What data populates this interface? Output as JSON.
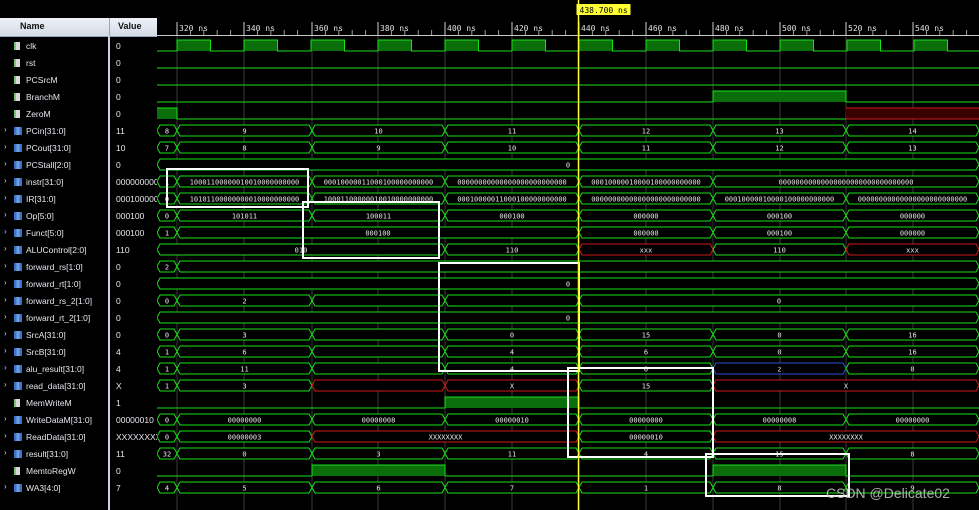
{
  "columns": {
    "name": "Name",
    "value": "Value"
  },
  "cursor": {
    "label": "438.700 ns"
  },
  "ruler": {
    "ticks": [
      "320 ns",
      "340 ns",
      "360 ns",
      "380 ns",
      "400 ns",
      "420 ns",
      "440 ns",
      "460 ns",
      "480 ns",
      "500 ns",
      "520 ns",
      "540 ns"
    ]
  },
  "signals": [
    {
      "name": "clk",
      "value": "0",
      "type": "bit"
    },
    {
      "name": "rst",
      "value": "0",
      "type": "bit"
    },
    {
      "name": "PCSrcM",
      "value": "0",
      "type": "bit"
    },
    {
      "name": "BranchM",
      "value": "0",
      "type": "bit"
    },
    {
      "name": "ZeroM",
      "value": "0",
      "type": "bit"
    },
    {
      "name": "PCin[31:0]",
      "value": "11",
      "type": "bus"
    },
    {
      "name": "PCout[31:0]",
      "value": "10",
      "type": "bus"
    },
    {
      "name": "PCStall[2:0]",
      "value": "0",
      "type": "bus"
    },
    {
      "name": "instr[31:0]",
      "value": "000000000",
      "type": "bus"
    },
    {
      "name": "IR[31:0]",
      "value": "000100000",
      "type": "bus"
    },
    {
      "name": "Op[5:0]",
      "value": "000100",
      "type": "bus"
    },
    {
      "name": "Funct[5:0]",
      "value": "000100",
      "type": "bus"
    },
    {
      "name": "ALUControl[2:0]",
      "value": "110",
      "type": "bus"
    },
    {
      "name": "forward_rs[1:0]",
      "value": "0",
      "type": "bus"
    },
    {
      "name": "forward_rt[1:0]",
      "value": "0",
      "type": "bus"
    },
    {
      "name": "forward_rs_2[1:0]",
      "value": "0",
      "type": "bus"
    },
    {
      "name": "forward_rt_2[1:0]",
      "value": "0",
      "type": "bus"
    },
    {
      "name": "SrcA[31:0]",
      "value": "0",
      "type": "bus"
    },
    {
      "name": "SrcB[31:0]",
      "value": "4",
      "type": "bus"
    },
    {
      "name": "alu_result[31:0]",
      "value": "4",
      "type": "bus"
    },
    {
      "name": "read_data[31:0]",
      "value": "X",
      "type": "bus"
    },
    {
      "name": "MemWriteM",
      "value": "1",
      "type": "bit"
    },
    {
      "name": "WriteDataM[31:0]",
      "value": "00000010",
      "type": "bus"
    },
    {
      "name": "ReadData[31:0]",
      "value": "XXXXXXXX",
      "type": "bus"
    },
    {
      "name": "result[31:0]",
      "value": "11",
      "type": "bus"
    },
    {
      "name": "MemtoRegW",
      "value": "0",
      "type": "bit"
    },
    {
      "name": "WA3[4:0]",
      "value": "7",
      "type": "bus"
    }
  ],
  "waves": [
    {
      "kind": "clk"
    },
    {
      "kind": "bit",
      "segs": [
        {
          "v": 0,
          "e": 822
        }
      ]
    },
    {
      "kind": "bit",
      "segs": [
        {
          "v": 0,
          "e": 822
        }
      ]
    },
    {
      "kind": "bit",
      "segs": [
        {
          "v": 0,
          "e": 556
        },
        {
          "v": 1,
          "e": 689
        },
        {
          "v": 0,
          "e": 822
        }
      ]
    },
    {
      "kind": "bit",
      "segs": [
        {
          "v": 1,
          "e": 20
        },
        {
          "v": 0,
          "e": 689
        },
        {
          "v": "x",
          "e": 822
        }
      ]
    },
    {
      "kind": "bus",
      "segs": [
        {
          "t": "8",
          "e": 20
        },
        {
          "t": "9",
          "e": 155
        },
        {
          "t": "10",
          "e": 288
        },
        {
          "t": "11",
          "e": 422
        },
        {
          "t": "12",
          "e": 556
        },
        {
          "t": "13",
          "e": 689
        },
        {
          "t": "14",
          "e": 822
        }
      ]
    },
    {
      "kind": "bus",
      "segs": [
        {
          "t": "7",
          "e": 20
        },
        {
          "t": "8",
          "e": 155
        },
        {
          "t": "9",
          "e": 288
        },
        {
          "t": "10",
          "e": 422
        },
        {
          "t": "11",
          "e": 556
        },
        {
          "t": "12",
          "e": 689
        },
        {
          "t": "13",
          "e": 822
        }
      ]
    },
    {
      "kind": "bus",
      "segs": [
        {
          "t": "0",
          "e": 822
        }
      ]
    },
    {
      "kind": "bus",
      "segs": [
        {
          "t": "1",
          "e": 20
        },
        {
          "t": "10001100000010010000000000",
          "e": 155
        },
        {
          "t": "00010000011000100000000000",
          "e": 288
        },
        {
          "t": "00000000000000000000000000",
          "e": 422
        },
        {
          "t": "00010000010000100000000000",
          "e": 556
        },
        {
          "t": "00000000000000000000000000000000",
          "e": 822
        }
      ]
    },
    {
      "kind": "bus",
      "segs": [
        {
          "t": "0",
          "e": 20
        },
        {
          "t": "10101100000000010000000000",
          "e": 155
        },
        {
          "t": "10001100000010010000000000",
          "e": 288
        },
        {
          "t": "00010000011000100000000000",
          "e": 422
        },
        {
          "t": "00000000000000000000000000",
          "e": 556
        },
        {
          "t": "00010000010000100000000000",
          "e": 689
        },
        {
          "t": "00000000000000000000000000",
          "e": 822
        }
      ]
    },
    {
      "kind": "bus",
      "segs": [
        {
          "t": "0",
          "e": 20
        },
        {
          "t": "101011",
          "e": 155
        },
        {
          "t": "100011",
          "e": 288
        },
        {
          "t": "000100",
          "e": 422
        },
        {
          "t": "000000",
          "e": 556
        },
        {
          "t": "000100",
          "e": 689
        },
        {
          "t": "000000",
          "e": 822
        }
      ]
    },
    {
      "kind": "bus",
      "segs": [
        {
          "t": "1",
          "e": 20
        },
        {
          "t": "000100",
          "e": 422
        },
        {
          "t": "000000",
          "e": 556
        },
        {
          "t": "000100",
          "e": 689
        },
        {
          "t": "000000",
          "e": 822
        }
      ]
    },
    {
      "kind": "bus",
      "segs": [
        {
          "t": "010",
          "e": 288
        },
        {
          "t": "110",
          "e": 422
        },
        {
          "t": "xxx",
          "e": 556,
          "x": true
        },
        {
          "t": "110",
          "e": 689
        },
        {
          "t": "xxx",
          "e": 822,
          "x": true
        }
      ]
    },
    {
      "kind": "bus",
      "segs": [
        {
          "t": "2",
          "e": 20
        },
        {
          "t": "",
          "e": 822
        }
      ]
    },
    {
      "kind": "bus",
      "segs": [
        {
          "t": "0",
          "e": 822
        }
      ]
    },
    {
      "kind": "bus",
      "segs": [
        {
          "t": "0",
          "e": 20
        },
        {
          "t": "2",
          "e": 155
        },
        {
          "t": "",
          "e": 288
        },
        {
          "t": "",
          "e": 422
        },
        {
          "t": "0",
          "e": 822
        }
      ]
    },
    {
      "kind": "bus",
      "segs": [
        {
          "t": "0",
          "e": 822
        }
      ]
    },
    {
      "kind": "bus",
      "segs": [
        {
          "t": "0",
          "e": 20
        },
        {
          "t": "3",
          "e": 155
        },
        {
          "t": "",
          "e": 288
        },
        {
          "t": "0",
          "e": 422
        },
        {
          "t": "15",
          "e": 556
        },
        {
          "t": "0",
          "e": 689
        },
        {
          "t": "16",
          "e": 822
        }
      ]
    },
    {
      "kind": "bus",
      "segs": [
        {
          "t": "1",
          "e": 20
        },
        {
          "t": "6",
          "e": 155
        },
        {
          "t": "",
          "e": 288
        },
        {
          "t": "4",
          "e": 422
        },
        {
          "t": "6",
          "e": 556
        },
        {
          "t": "0",
          "e": 689
        },
        {
          "t": "16",
          "e": 822
        }
      ]
    },
    {
      "kind": "bus",
      "segs": [
        {
          "t": "1",
          "e": 20
        },
        {
          "t": "11",
          "e": 155
        },
        {
          "t": "",
          "e": 288
        },
        {
          "t": "4",
          "e": 422
        },
        {
          "t": "0",
          "e": 556
        },
        {
          "t": "z",
          "e": 689,
          "z": true
        },
        {
          "t": "0",
          "e": 822
        }
      ]
    },
    {
      "kind": "bus",
      "segs": [
        {
          "t": "1",
          "e": 20
        },
        {
          "t": "3",
          "e": 155
        },
        {
          "t": "",
          "e": 288,
          "x": true
        },
        {
          "t": "X",
          "e": 422,
          "x": true
        },
        {
          "t": "15",
          "e": 556
        },
        {
          "t": "X",
          "e": 822,
          "x": true
        }
      ]
    },
    {
      "kind": "bit",
      "segs": [
        {
          "v": 0,
          "e": 288
        },
        {
          "v": 1,
          "e": 422
        },
        {
          "v": 0,
          "e": 822
        }
      ]
    },
    {
      "kind": "bus",
      "segs": [
        {
          "t": "0",
          "e": 20
        },
        {
          "t": "00000000",
          "e": 155
        },
        {
          "t": "00000008",
          "e": 288
        },
        {
          "t": "00000010",
          "e": 422
        },
        {
          "t": "00000000",
          "e": 556
        },
        {
          "t": "00000008",
          "e": 689
        },
        {
          "t": "00000000",
          "e": 822
        }
      ]
    },
    {
      "kind": "bus",
      "segs": [
        {
          "t": "0",
          "e": 20
        },
        {
          "t": "00000003",
          "e": 155
        },
        {
          "t": "XXXXXXXX",
          "e": 422,
          "x": true
        },
        {
          "t": "00000010",
          "e": 556
        },
        {
          "t": "XXXXXXXX",
          "e": 822,
          "x": true
        }
      ]
    },
    {
      "kind": "bus",
      "segs": [
        {
          "t": "32",
          "e": 20
        },
        {
          "t": "0",
          "e": 155
        },
        {
          "t": "3",
          "e": 288
        },
        {
          "t": "11",
          "e": 422
        },
        {
          "t": "4",
          "e": 556
        },
        {
          "t": "15",
          "e": 689
        },
        {
          "t": "8",
          "e": 822
        }
      ]
    },
    {
      "kind": "bit",
      "segs": [
        {
          "v": 0,
          "e": 155
        },
        {
          "v": 1,
          "e": 288
        },
        {
          "v": 0,
          "e": 556
        },
        {
          "v": 1,
          "e": 689
        },
        {
          "v": 0,
          "e": 822
        }
      ]
    },
    {
      "kind": "bus",
      "segs": [
        {
          "t": "4",
          "e": 20
        },
        {
          "t": "5",
          "e": 155
        },
        {
          "t": "6",
          "e": 288
        },
        {
          "t": "7",
          "e": 422
        },
        {
          "t": "1",
          "e": 556
        },
        {
          "t": "8",
          "e": 689
        },
        {
          "t": "9",
          "e": 822
        }
      ]
    }
  ],
  "colors": {
    "wave": "#19e019",
    "busFill": "#000000",
    "xColor": "#d11a1a",
    "zColor": "#2a4fd6",
    "cursor": "#ffff33",
    "hi": "#0a6e0a"
  },
  "watermark": "CSDN @Delicate02"
}
